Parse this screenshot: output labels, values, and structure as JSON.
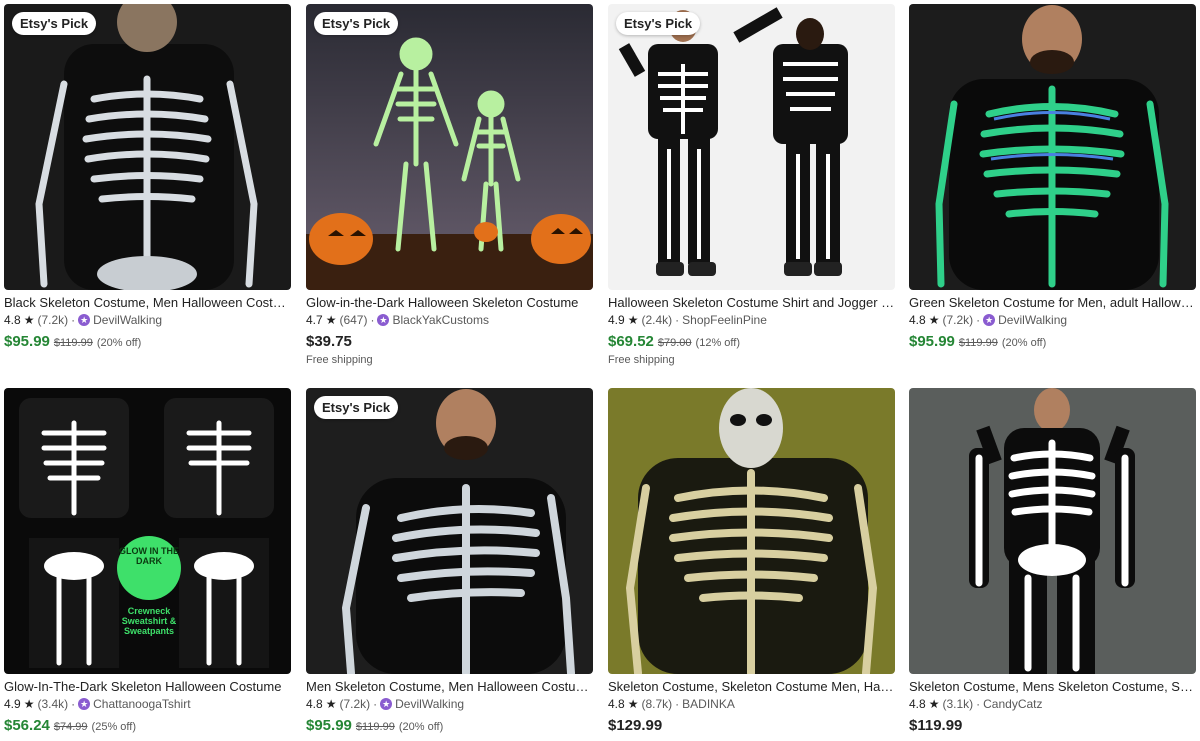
{
  "listings": [
    {
      "badge": "Etsy's Pick",
      "title": "Black Skeleton Costume, Men Halloween Costume",
      "rating": "4.8",
      "reviews": "(7.2k)",
      "star_seller": true,
      "shop": "DevilWalking",
      "price": "$95.99",
      "original_price": "$119.99",
      "discount": "(20% off)",
      "shipping": ""
    },
    {
      "badge": "Etsy's Pick",
      "title": "Glow-in-the-Dark Halloween Skeleton Costume",
      "rating": "4.7",
      "reviews": "(647)",
      "star_seller": true,
      "shop": "BlackYakCustoms",
      "price": "$39.75",
      "original_price": "",
      "discount": "",
      "shipping": "Free shipping"
    },
    {
      "badge": "Etsy's Pick",
      "title": "Halloween Skeleton Costume Shirt and Jogger Set",
      "rating": "4.9",
      "reviews": "(2.4k)",
      "star_seller": false,
      "shop": "ShopFeelinPine",
      "price": "$69.52",
      "original_price": "$79.00",
      "discount": "(12% off)",
      "shipping": "Free shipping"
    },
    {
      "badge": "",
      "title": "Green Skeleton Costume for Men, adult Halloween Costume",
      "rating": "4.8",
      "reviews": "(7.2k)",
      "star_seller": true,
      "shop": "DevilWalking",
      "price": "$95.99",
      "original_price": "$119.99",
      "discount": "(20% off)",
      "shipping": ""
    },
    {
      "badge": "",
      "title": "Glow-In-The-Dark Skeleton Halloween Costume",
      "rating": "4.9",
      "reviews": "(3.4k)",
      "star_seller": true,
      "shop": "ChattanoogaTshirt",
      "price": "$56.24",
      "original_price": "$74.99",
      "discount": "(25% off)",
      "shipping": ""
    },
    {
      "badge": "Etsy's Pick",
      "title": "Men Skeleton Costume, Men Halloween Costume",
      "rating": "4.8",
      "reviews": "(7.2k)",
      "star_seller": true,
      "shop": "DevilWalking",
      "price": "$95.99",
      "original_price": "$119.99",
      "discount": "(20% off)",
      "shipping": ""
    },
    {
      "badge": "",
      "title": "Skeleton Costume, Skeleton Costume Men, Halloween",
      "rating": "4.8",
      "reviews": "(8.7k)",
      "star_seller": false,
      "shop": "BADINKA",
      "price": "$129.99",
      "original_price": "",
      "discount": "",
      "shipping": ""
    },
    {
      "badge": "",
      "title": "Skeleton Costume, Mens Skeleton Costume, Skeleton",
      "rating": "4.8",
      "reviews": "(3.1k)",
      "star_seller": false,
      "shop": "CandyCatz",
      "price": "$119.99",
      "original_price": "",
      "discount": "",
      "shipping": ""
    }
  ],
  "overlay_text": {
    "glow_badge": "GLOW IN THE DARK",
    "crewneck_caption": "Crewneck Sweatshirt & Sweatpants"
  },
  "colors": {
    "sale_price": "#258635",
    "star_seller_badge": "#8a5cd0",
    "glow_green": "#b8f0a0"
  }
}
